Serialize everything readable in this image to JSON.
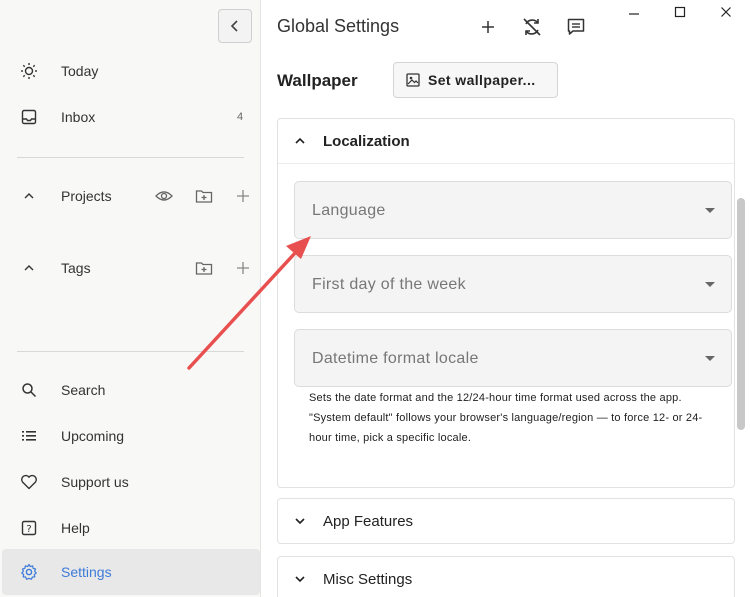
{
  "sidebar": {
    "nav_top": [
      {
        "label": "Today",
        "icon": "sun-icon"
      },
      {
        "label": "Inbox",
        "icon": "inbox-icon",
        "count": "4"
      }
    ],
    "projects": {
      "label": "Projects"
    },
    "tags": {
      "label": "Tags"
    },
    "nav_bottom": [
      {
        "label": "Search",
        "icon": "search-icon"
      },
      {
        "label": "Upcoming",
        "icon": "list-icon"
      },
      {
        "label": "Support us",
        "icon": "heart-icon"
      },
      {
        "label": "Help",
        "icon": "help-icon"
      },
      {
        "label": "Settings",
        "icon": "gear-icon"
      }
    ]
  },
  "header": {
    "title": "Global Settings"
  },
  "wallpaper": {
    "label": "Wallpaper",
    "button_label": "Set wallpaper..."
  },
  "localization": {
    "title": "Localization",
    "fields": [
      {
        "label": "Language"
      },
      {
        "label": "First day of the week"
      },
      {
        "label": "Datetime format locale"
      }
    ],
    "hint": "Sets the date format and the 12/24-hour time format used across the app. \"System default\" follows your browser's language/region — to force 12- or 24-hour time, pick a specific locale."
  },
  "sections": [
    {
      "title": "App Features"
    },
    {
      "title": "Misc Settings"
    }
  ],
  "colors": {
    "accent": "#3d7bd9",
    "arrow": "#e8504f"
  }
}
